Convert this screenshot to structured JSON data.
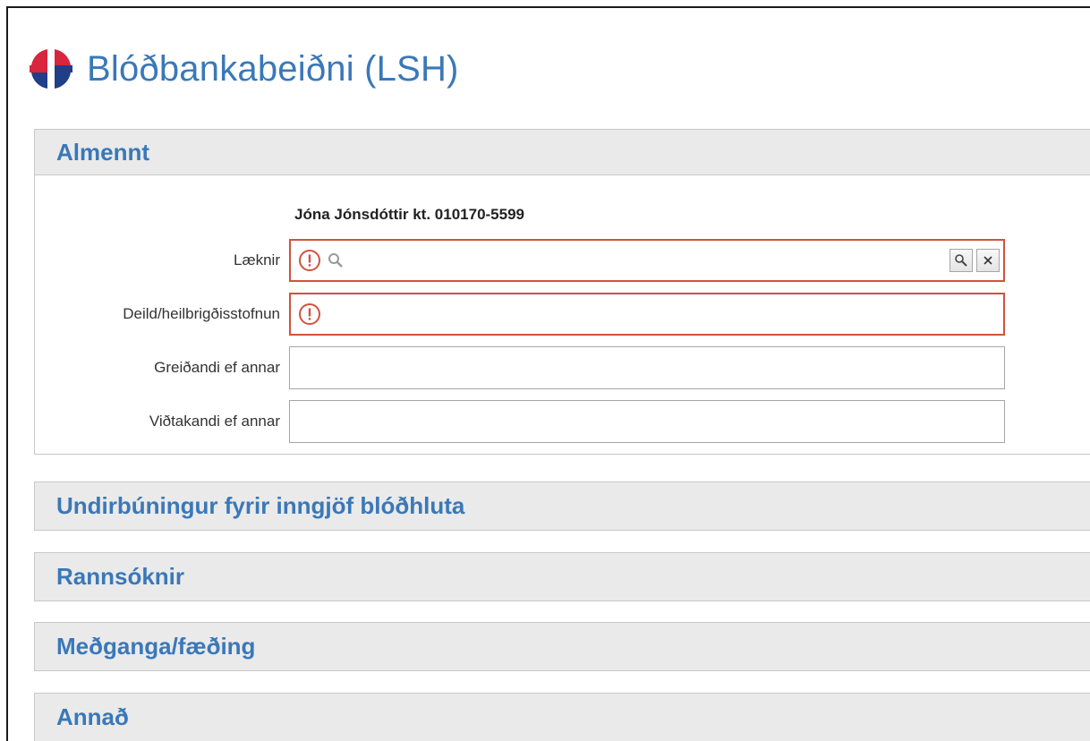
{
  "app": {
    "title": "Blóðbankabeiðni (LSH)",
    "accent_color": "#3a78b8",
    "logo_colors": {
      "red": "#d7263d",
      "blue": "#1f3f86"
    }
  },
  "sections": {
    "almennt": {
      "title": "Almennt",
      "patient": "Jóna Jónsdóttir kt. 010170-5599",
      "fields": {
        "laeknir": {
          "label": "Læknir",
          "value": "",
          "error": true
        },
        "deild": {
          "label": "Deild/heilbrigðisstofnun",
          "value": "",
          "error": true
        },
        "greidandi": {
          "label": "Greiðandi ef annar",
          "value": ""
        },
        "vidtakandi": {
          "label": "Viðtakandi ef annar",
          "value": ""
        }
      },
      "icons": {
        "error": "exclamation-circle-icon",
        "search": "magnifier-icon",
        "lookup": "magnifier-icon",
        "clear": "close-icon"
      },
      "error_color": "#d0533c"
    },
    "undirbuningur": {
      "title": "Undirbúningur fyrir inngjöf blóðhluta"
    },
    "rannsoknir": {
      "title": "Rannsóknir"
    },
    "medganga": {
      "title": "Meðganga/fæðing"
    },
    "annad": {
      "title": "Annað"
    }
  }
}
